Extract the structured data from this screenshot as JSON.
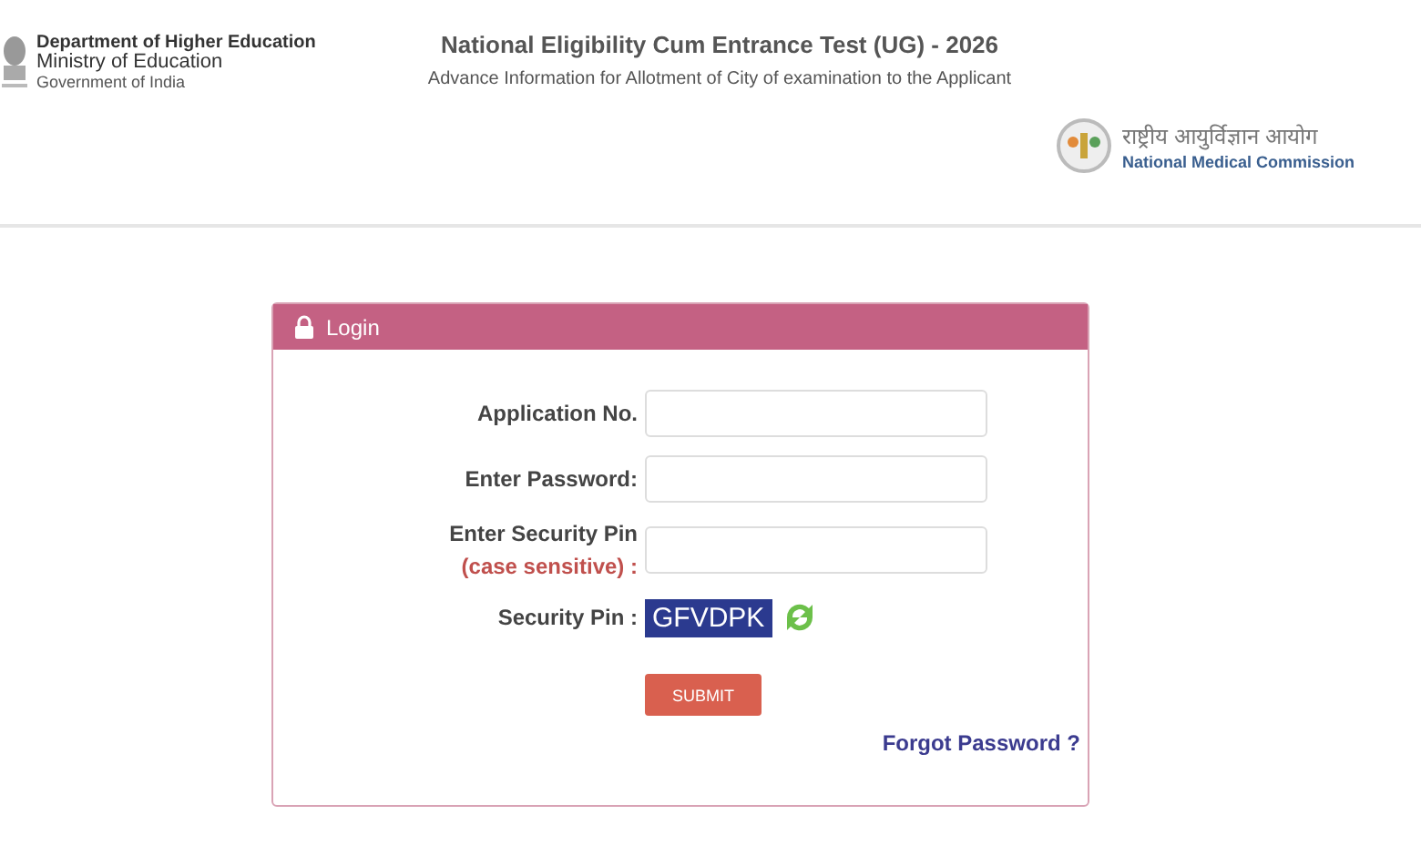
{
  "header": {
    "ministry": {
      "department": "Department of Higher Education",
      "ministry": "Ministry of Education",
      "government": "Government of India"
    },
    "title": "National Eligibility Cum Entrance Test (UG) - 2026",
    "subtitle": "Advance Information for Allotment of City of examination to the Applicant",
    "commission": {
      "name_hindi": "राष्ट्रीय आयुर्विज्ञान आयोग",
      "name": "National Medical Commission"
    }
  },
  "login": {
    "title": "Login",
    "fields": [
      {
        "label": "Application No."
      },
      {
        "label": "Enter Password:"
      },
      {
        "label": "Enter Security Pin",
        "note": "(case sensitive) :"
      }
    ],
    "captcha_label": "Security Pin :",
    "captcha": "GFVDPK",
    "submit": "SUBMIT",
    "forgot": "Forgot Password ?"
  }
}
